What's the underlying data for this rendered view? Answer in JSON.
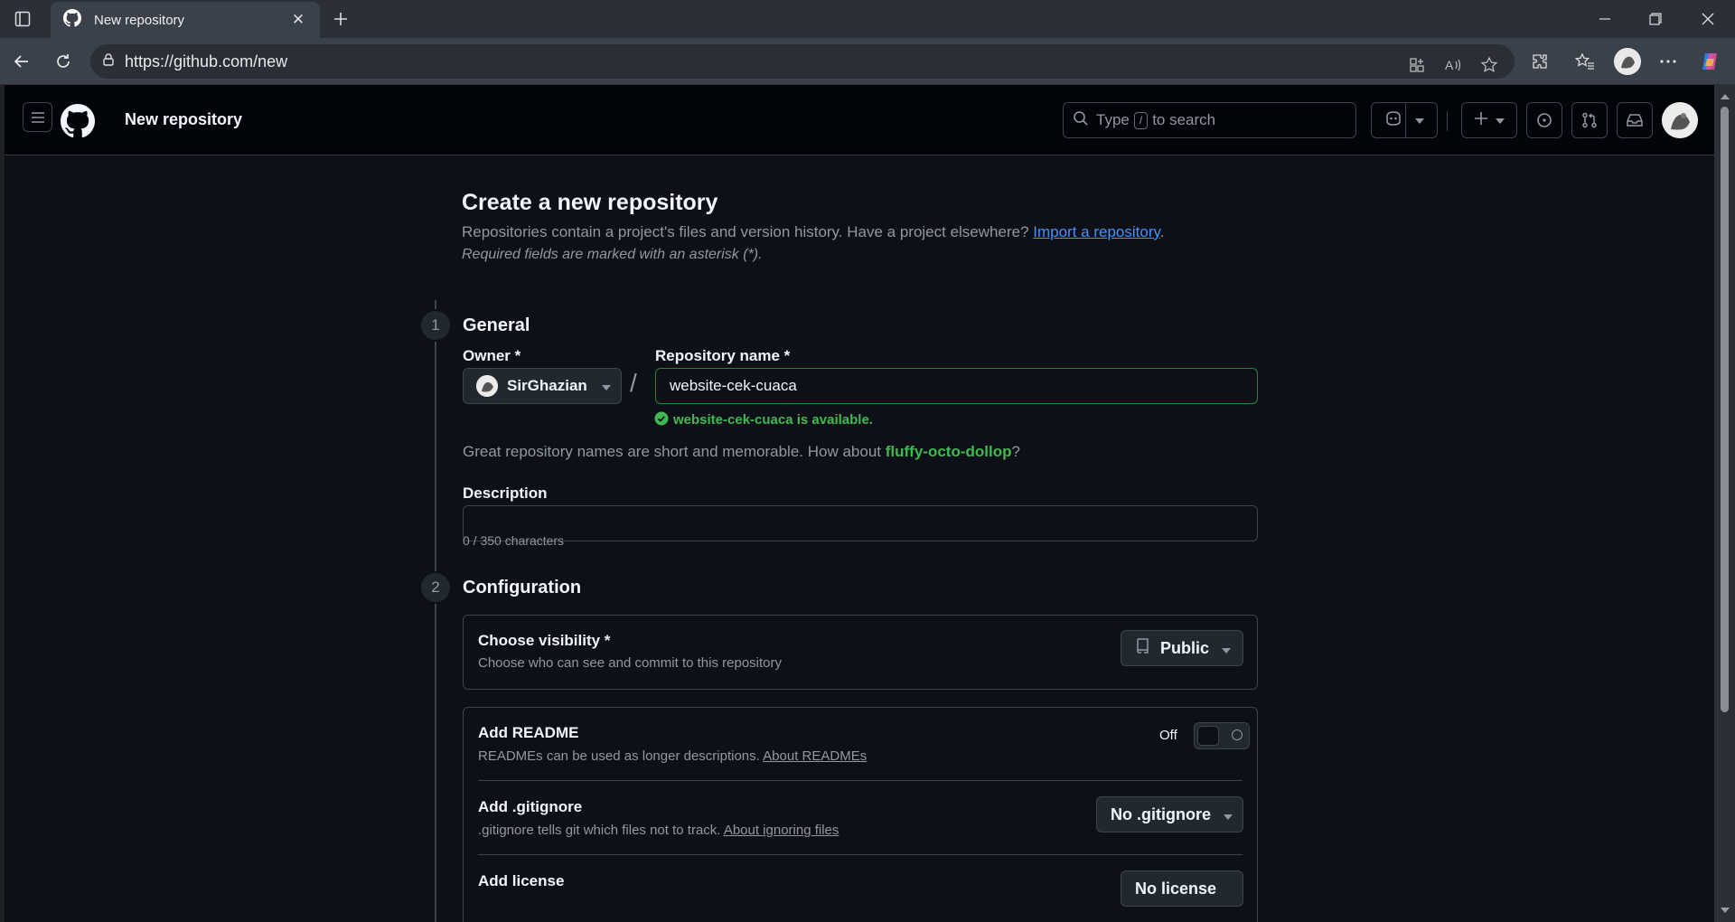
{
  "browser": {
    "tab_title": "New repository",
    "url": "https://github.com/new"
  },
  "header": {
    "title": "New repository",
    "search_prefix": "Type",
    "search_key": "/",
    "search_suffix": "to search"
  },
  "page": {
    "heading": "Create a new repository",
    "lead_text": "Repositories contain a project's files and version history. Have a project elsewhere?",
    "import_link": "Import a repository",
    "lead_end": ".",
    "required_note": "Required fields are marked with an asterisk (*)."
  },
  "general": {
    "step": "1",
    "title": "General",
    "owner_label": "Owner *",
    "owner_value": "SirGhazian",
    "slash": "/",
    "name_label": "Repository name *",
    "name_value": "website-cek-cuaca",
    "availability": "website-cek-cuaca is available.",
    "suggest_text": "Great repository names are short and memorable. How about",
    "suggest_name": "fluffy-octo-dollop",
    "suggest_end": "?",
    "description_label": "Description",
    "description_value": "",
    "char_count": "0 / 350 characters"
  },
  "configuration": {
    "step": "2",
    "title": "Configuration",
    "visibility_title": "Choose visibility *",
    "visibility_desc": "Choose who can see and commit to this repository",
    "visibility_value": "Public",
    "readme_title": "Add README",
    "readme_desc": "READMEs can be used as longer descriptions.",
    "readme_link": "About READMEs",
    "readme_state": "Off",
    "gitignore_title": "Add .gitignore",
    "gitignore_desc": ".gitignore tells git which files not to track.",
    "gitignore_link": "About ignoring files",
    "gitignore_value": "No .gitignore",
    "license_title": "Add license",
    "license_value": "No license"
  },
  "colors": {
    "page_bg": "#0d1117",
    "header_bg": "#010409",
    "success": "#3fb950",
    "link": "#4493f8",
    "border": "#3d444d"
  }
}
